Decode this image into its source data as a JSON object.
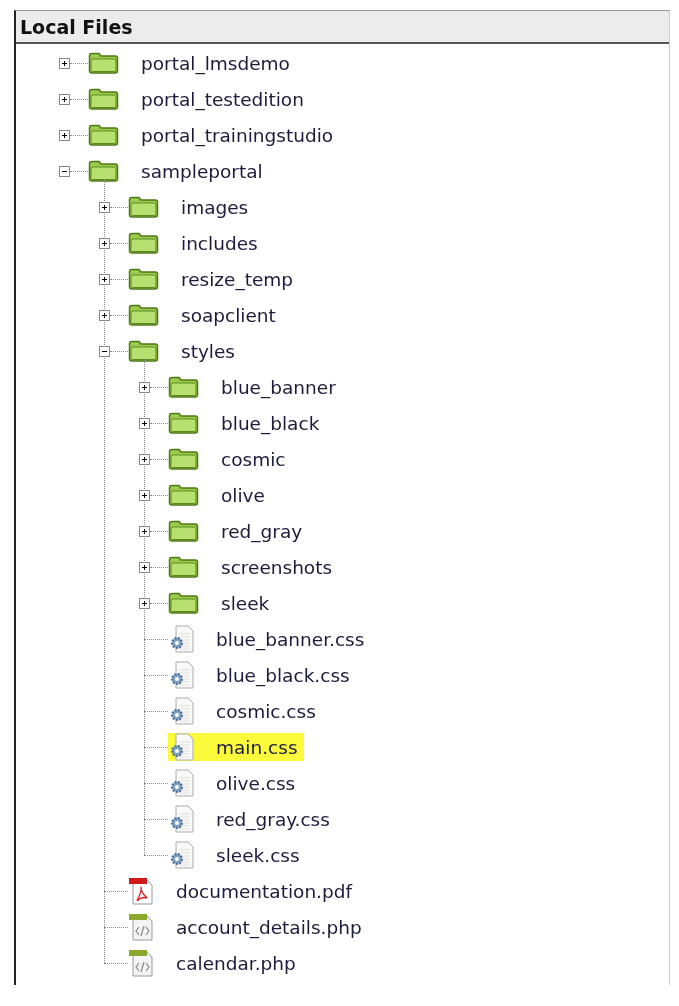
{
  "panel": {
    "title": "Local Files"
  },
  "tree": [
    {
      "name": "portal_lmsdemo",
      "kind": "folder",
      "expanded": false,
      "selected": false
    },
    {
      "name": "portal_testedition",
      "kind": "folder",
      "expanded": false,
      "selected": false
    },
    {
      "name": "portal_trainingstudio",
      "kind": "folder",
      "expanded": false,
      "selected": false
    },
    {
      "name": "sampleportal",
      "kind": "folder",
      "expanded": true,
      "selected": false,
      "children": [
        {
          "name": "images",
          "kind": "folder",
          "expanded": false,
          "selected": false
        },
        {
          "name": "includes",
          "kind": "folder",
          "expanded": false,
          "selected": false
        },
        {
          "name": "resize_temp",
          "kind": "folder",
          "expanded": false,
          "selected": false
        },
        {
          "name": "soapclient",
          "kind": "folder",
          "expanded": false,
          "selected": false
        },
        {
          "name": "styles",
          "kind": "folder",
          "expanded": true,
          "selected": false,
          "children": [
            {
              "name": "blue_banner",
              "kind": "folder",
              "expanded": false,
              "selected": false
            },
            {
              "name": "blue_black",
              "kind": "folder",
              "expanded": false,
              "selected": false
            },
            {
              "name": "cosmic",
              "kind": "folder",
              "expanded": false,
              "selected": false
            },
            {
              "name": "olive",
              "kind": "folder",
              "expanded": false,
              "selected": false
            },
            {
              "name": "red_gray",
              "kind": "folder",
              "expanded": false,
              "selected": false
            },
            {
              "name": "screenshots",
              "kind": "folder",
              "expanded": false,
              "selected": false
            },
            {
              "name": "sleek",
              "kind": "folder",
              "expanded": false,
              "selected": false
            },
            {
              "name": "blue_banner.css",
              "kind": "css",
              "selected": false
            },
            {
              "name": "blue_black.css",
              "kind": "css",
              "selected": false
            },
            {
              "name": "cosmic.css",
              "kind": "css",
              "selected": false
            },
            {
              "name": "main.css",
              "kind": "css",
              "selected": true
            },
            {
              "name": "olive.css",
              "kind": "css",
              "selected": false
            },
            {
              "name": "red_gray.css",
              "kind": "css",
              "selected": false
            },
            {
              "name": "sleek.css",
              "kind": "css",
              "selected": false
            }
          ]
        },
        {
          "name": "documentation.pdf",
          "kind": "pdf",
          "selected": false
        },
        {
          "name": "account_details.php",
          "kind": "php",
          "selected": false
        },
        {
          "name": "calendar.php",
          "kind": "php",
          "selected": false
        }
      ]
    }
  ]
}
